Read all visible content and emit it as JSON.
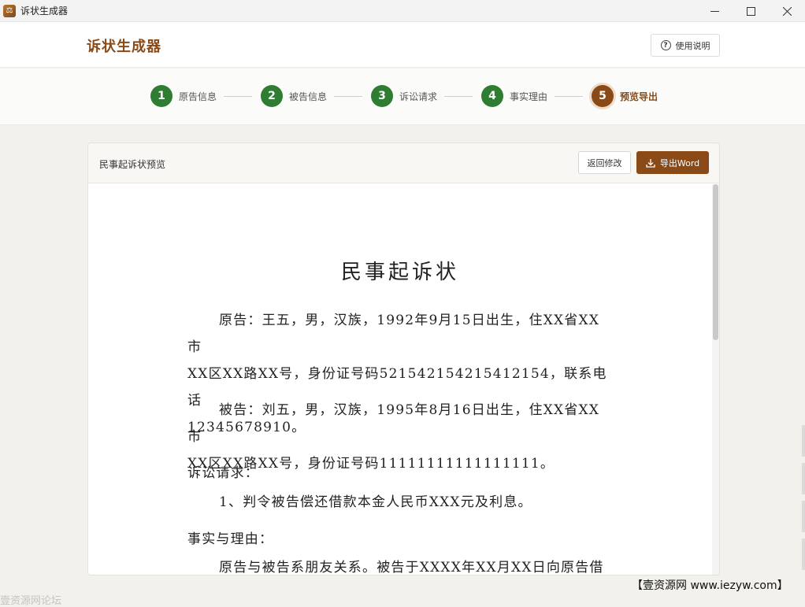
{
  "window": {
    "title": "诉状生成器",
    "icon": "app-icon",
    "controls": {
      "minimize": "—",
      "maximize": "☐",
      "close": "✕"
    }
  },
  "header": {
    "brand": "诉状生成器",
    "help_label": "使用说明",
    "help_icon": "question-circle-icon"
  },
  "stepper": {
    "steps": [
      {
        "num": "1",
        "label": "原告信息",
        "status": "done"
      },
      {
        "num": "2",
        "label": "被告信息",
        "status": "done"
      },
      {
        "num": "3",
        "label": "诉讼请求",
        "status": "done"
      },
      {
        "num": "4",
        "label": "事实理由",
        "status": "done"
      },
      {
        "num": "5",
        "label": "预览导出",
        "status": "active"
      }
    ]
  },
  "preview": {
    "title": "民事起诉状预览",
    "back_label": "返回修改",
    "export_label": "导出Word",
    "export_icon": "download-icon",
    "document": {
      "title": "民事起诉状",
      "plaintiff": [
        "原告：王五，男，汉族，1992年9月15日出生，住XX省XX市",
        "XX区XX路XX号，身份证号码521542154215412154，联系电话",
        "12345678910。"
      ],
      "defendant": [
        "被告：刘五，男，汉族，1995年8月16日出生，住XX省XX市",
        "XX区XX路XX号，身份证号码11111111111111111。"
      ],
      "claims_heading": "诉讼请求：",
      "claims": [
        "1、判令被告偿还借款本金人民币XXX元及利息。"
      ],
      "facts_heading": "事实与理由：",
      "facts": [
        "原告与被告系朋友关系。被告于XXXX年XX月XX日向原告借款"
      ]
    }
  },
  "watermarks": {
    "bottom_right": "【壹资源网 www.iezyw.com】",
    "bottom_left": "壹资源网论坛"
  },
  "colors": {
    "brand": "#8a4a17",
    "step_done": "#2e7d32",
    "background": "#f2f1ec"
  }
}
